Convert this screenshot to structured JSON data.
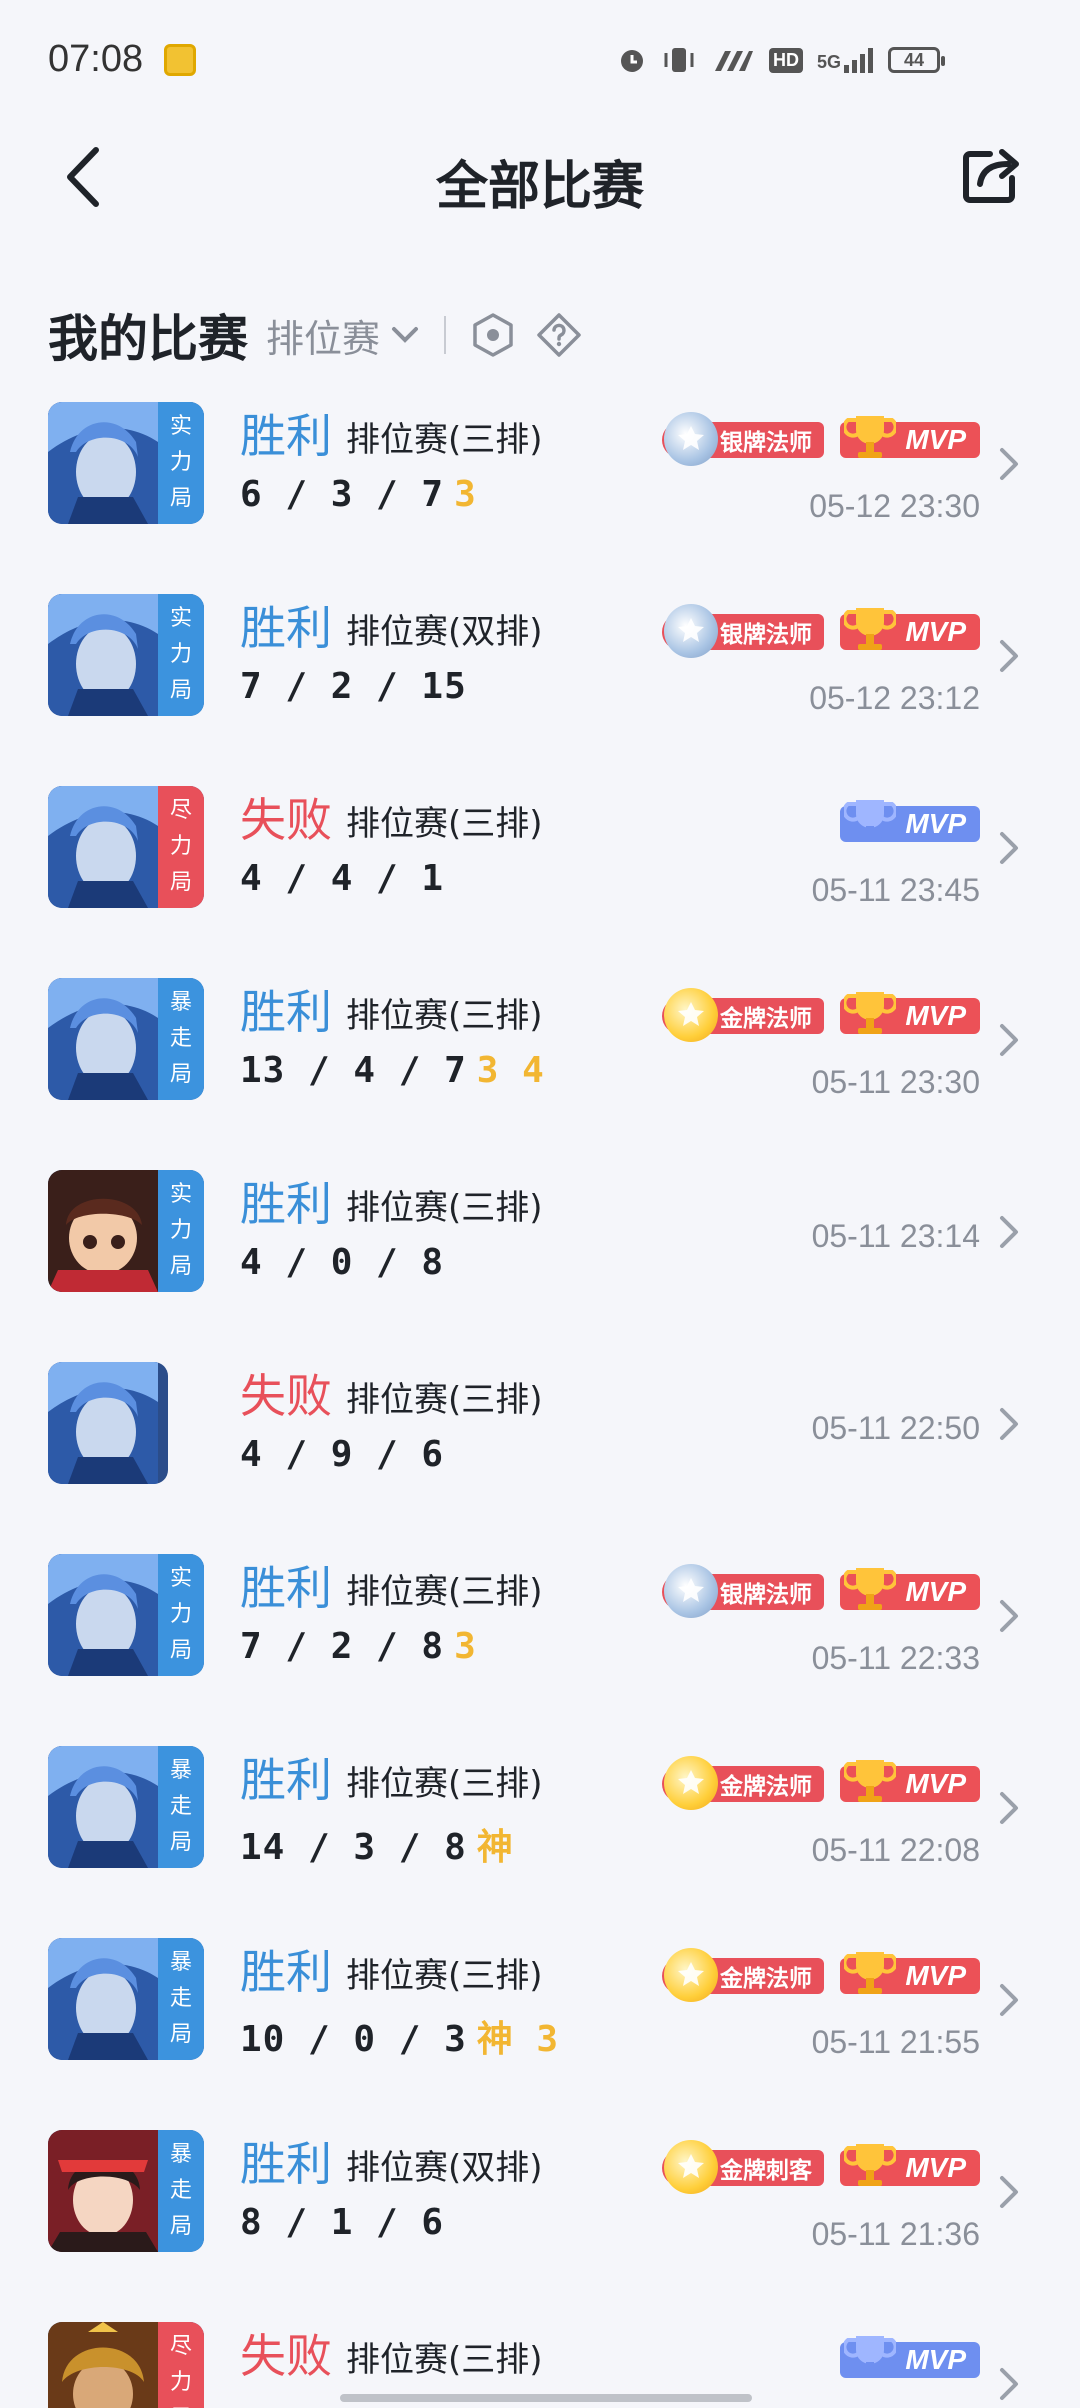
{
  "status": {
    "time": "07:08",
    "network": "5G",
    "hd": "HD",
    "battery": "44"
  },
  "header": {
    "title": "全部比赛"
  },
  "section": {
    "title": "我的比赛",
    "filter_label": "排位赛"
  },
  "matches": [
    {
      "result": "胜利",
      "outcome": "win",
      "mode": "排位赛(三排)",
      "kda": "6 / 3 / 7",
      "extra": "3",
      "tag": "实力局",
      "tag_color": "#3c93de",
      "avatar_style": "blue",
      "title_badge": "银牌法师",
      "title_badge_type": "silver",
      "mvp": "MVP",
      "mvp_type": "red",
      "time": "05-12 23:30"
    },
    {
      "result": "胜利",
      "outcome": "win",
      "mode": "排位赛(双排)",
      "kda": "7 / 2 / 15",
      "extra": "",
      "tag": "实力局",
      "tag_color": "#3c93de",
      "avatar_style": "blue",
      "title_badge": "银牌法师",
      "title_badge_type": "silver",
      "mvp": "MVP",
      "mvp_type": "red",
      "time": "05-12 23:12"
    },
    {
      "result": "失败",
      "outcome": "lose",
      "mode": "排位赛(三排)",
      "kda": "4 / 4 / 1",
      "extra": "",
      "tag": "尽力局",
      "tag_color": "#e8505a",
      "avatar_style": "blue",
      "title_badge": "",
      "title_badge_type": "",
      "mvp": "MVP",
      "mvp_type": "blue",
      "time": "05-11 23:45"
    },
    {
      "result": "胜利",
      "outcome": "win",
      "mode": "排位赛(三排)",
      "kda": "13 / 4 / 7",
      "extra": "3 4",
      "tag": "暴走局",
      "tag_color": "#3c93de",
      "avatar_style": "blue",
      "title_badge": "金牌法师",
      "title_badge_type": "gold",
      "mvp": "MVP",
      "mvp_type": "red",
      "time": "05-11 23:30"
    },
    {
      "result": "胜利",
      "outcome": "win",
      "mode": "排位赛(三排)",
      "kda": "4 / 0 / 8",
      "extra": "",
      "tag": "实力局",
      "tag_color": "#3c93de",
      "avatar_style": "red",
      "title_badge": "",
      "title_badge_type": "",
      "mvp": "",
      "mvp_type": "",
      "time": "05-11 23:14"
    },
    {
      "result": "失败",
      "outcome": "lose",
      "mode": "排位赛(三排)",
      "kda": "4 / 9 / 6",
      "extra": "",
      "tag": "",
      "tag_color": "",
      "avatar_style": "blue",
      "title_badge": "",
      "title_badge_type": "",
      "mvp": "",
      "mvp_type": "",
      "time": "05-11 22:50"
    },
    {
      "result": "胜利",
      "outcome": "win",
      "mode": "排位赛(三排)",
      "kda": "7 / 2 / 8",
      "extra": "3",
      "tag": "实力局",
      "tag_color": "#3c93de",
      "avatar_style": "blue",
      "title_badge": "银牌法师",
      "title_badge_type": "silver",
      "mvp": "MVP",
      "mvp_type": "red",
      "time": "05-11 22:33"
    },
    {
      "result": "胜利",
      "outcome": "win",
      "mode": "排位赛(三排)",
      "kda": "14 / 3 / 8",
      "extra": "神",
      "tag": "暴走局",
      "tag_color": "#3c93de",
      "avatar_style": "blue",
      "title_badge": "金牌法师",
      "title_badge_type": "gold",
      "mvp": "MVP",
      "mvp_type": "red",
      "time": "05-11 22:08"
    },
    {
      "result": "胜利",
      "outcome": "win",
      "mode": "排位赛(三排)",
      "kda": "10 / 0 / 3",
      "extra": "神 3",
      "tag": "暴走局",
      "tag_color": "#3c93de",
      "avatar_style": "blue",
      "title_badge": "金牌法师",
      "title_badge_type": "gold",
      "mvp": "MVP",
      "mvp_type": "red",
      "time": "05-11 21:55"
    },
    {
      "result": "胜利",
      "outcome": "win",
      "mode": "排位赛(双排)",
      "kda": "8 / 1 / 6",
      "extra": "",
      "tag": "暴走局",
      "tag_color": "#3c93de",
      "avatar_style": "girl",
      "title_badge": "金牌刺客",
      "title_badge_type": "gold",
      "mvp": "MVP",
      "mvp_type": "red",
      "time": "05-11 21:36"
    },
    {
      "result": "失败",
      "outcome": "lose",
      "mode": "排位赛(三排)",
      "kda": "",
      "extra": "",
      "tag": "尽力局",
      "tag_color": "#e8505a",
      "avatar_style": "gold",
      "title_badge": "",
      "title_badge_type": "",
      "mvp": "MVP",
      "mvp_type": "blue",
      "time": ""
    }
  ]
}
